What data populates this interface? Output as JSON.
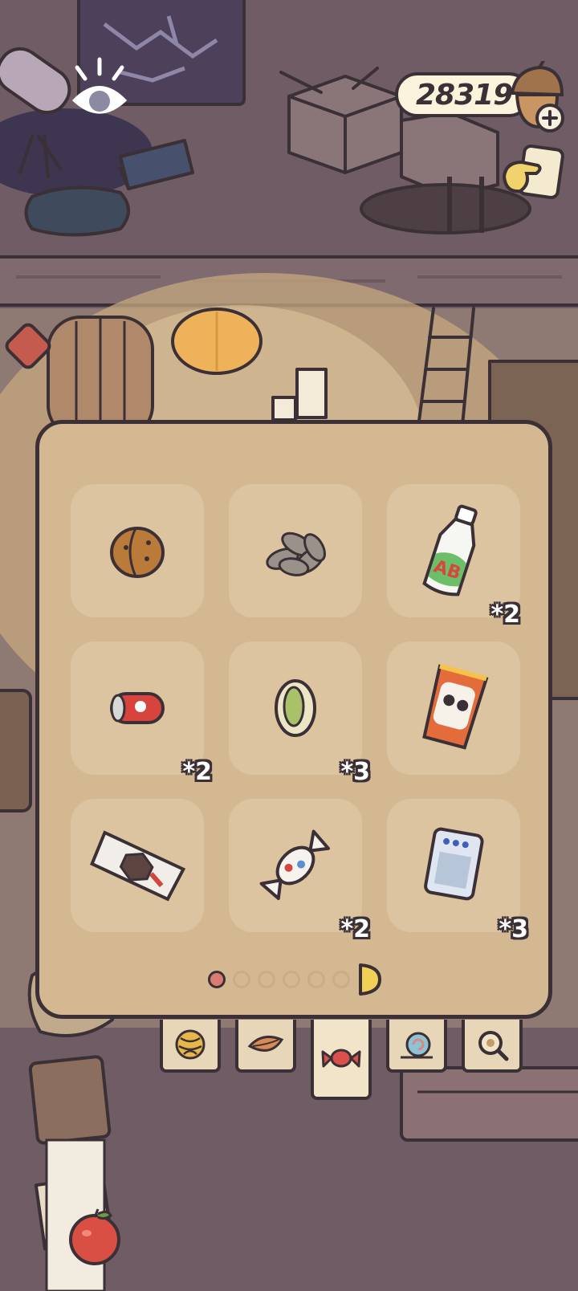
{
  "currency": {
    "value": "28319",
    "icon": "acorn-icon",
    "add_icon": "plus-icon"
  },
  "hud": {
    "eye_icon": "eye-icon",
    "hand_icon": "pointing-hand-icon"
  },
  "inventory": {
    "items": [
      {
        "name": "walnut",
        "icon": "walnut-icon",
        "qty": ""
      },
      {
        "name": "sunflower-seeds",
        "icon": "seeds-icon",
        "qty": ""
      },
      {
        "name": "milk-bottle",
        "icon": "milk-bottle-icon",
        "label": "AB",
        "qty": "*2"
      },
      {
        "name": "soda-can",
        "icon": "can-icon",
        "qty": "*2"
      },
      {
        "name": "pistachio",
        "icon": "pistachio-icon",
        "qty": "*3"
      },
      {
        "name": "snack-bag",
        "icon": "snack-bag-icon",
        "qty": ""
      },
      {
        "name": "chocolate-bar",
        "icon": "chocolate-icon",
        "qty": ""
      },
      {
        "name": "candy",
        "icon": "candy-icon",
        "qty": "*2"
      },
      {
        "name": "juice-pack",
        "icon": "juice-pack-icon",
        "qty": "*3"
      }
    ],
    "pagination": {
      "total_pages": 6,
      "current_page": 1
    }
  },
  "tabs": [
    {
      "name": "yarn",
      "icon": "yarn-icon",
      "active": false
    },
    {
      "name": "leaf",
      "icon": "leaf-icon",
      "active": false
    },
    {
      "name": "candy",
      "icon": "candy-icon",
      "active": true
    },
    {
      "name": "snail",
      "icon": "snail-icon",
      "active": false
    },
    {
      "name": "search",
      "icon": "magnifier-icon",
      "active": false
    }
  ],
  "colors": {
    "panel": "#d3b892",
    "slot": "#dcc4a1",
    "outline": "#3a3035",
    "active_dot": "#d97b73",
    "wall": "#6f5c64"
  }
}
